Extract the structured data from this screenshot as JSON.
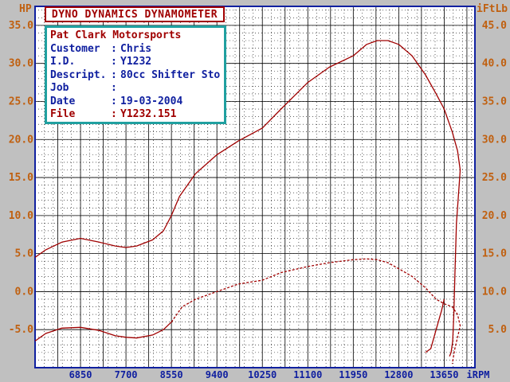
{
  "header": {
    "title": "DYNO DYNAMICS DYNAMOMETER",
    "left_axis_unit": "HP",
    "right_axis_unit": "iFtLb",
    "x_axis_unit": "iRPM"
  },
  "info": {
    "company": "Pat Clark Motorsports",
    "rows": [
      {
        "label": "Customer",
        "sep": ":",
        "value": "Chris"
      },
      {
        "label": "I.D.",
        "sep": ":",
        "value": "Y1232"
      },
      {
        "label": "Descript.",
        "sep": ":",
        "value": "80cc Shifter Sto"
      },
      {
        "label": "Job",
        "sep": ":",
        "value": ""
      },
      {
        "label": "Date",
        "sep": ":",
        "value": "19-03-2004"
      },
      {
        "label": "File",
        "sep": ":",
        "value": "Y1232.151"
      }
    ]
  },
  "colors": {
    "background": "#c0c0c0",
    "plot_bg": "#ffffff",
    "grid": "#000000",
    "axis_frame": "#1020a0",
    "left_tick_text": "#c06010",
    "right_tick_text": "#c06010",
    "x_tick_text": "#1020a0",
    "curve": "#a00000",
    "title_border": "#a00000",
    "info_border": "#20a0a0"
  },
  "chart_data": {
    "type": "line",
    "xlabel": "iRPM",
    "ylabel": "HP",
    "y2label": "iFtLb",
    "xlim": [
      6000,
      14225
    ],
    "ylim": [
      -10,
      37.5
    ],
    "y2lim": [
      0,
      47.5
    ],
    "x_ticks": [
      6850,
      7700,
      8550,
      9400,
      10250,
      11100,
      11950,
      12800,
      13650
    ],
    "y_ticks": [
      -5.0,
      0.0,
      5.0,
      10.0,
      15.0,
      20.0,
      25.0,
      30.0,
      35.0
    ],
    "y_tick_labels": [
      "-5.0",
      "0.0",
      "5.0",
      "10.0",
      "15.0",
      "20.0",
      "25.0",
      "30.0",
      "35.0"
    ],
    "y2_ticks": [
      5.0,
      10.0,
      15.0,
      20.0,
      25.0,
      30.0,
      35.0,
      40.0,
      45.0
    ],
    "y2_tick_labels": [
      "5.0",
      "10.0",
      "15.0",
      "20.0",
      "25.0",
      "30.0",
      "35.0",
      "40.0",
      "45.0"
    ],
    "grid": true,
    "series": [
      {
        "axis": "right",
        "style": "solid",
        "x": [
          6000,
          6200,
          6500,
          6850,
          7200,
          7500,
          7700,
          7900,
          8200,
          8400,
          8550,
          8700,
          9000,
          9400,
          9800,
          10250,
          10600,
          11100,
          11500,
          11950,
          12200,
          12400,
          12600,
          12800,
          13050,
          13300,
          13500,
          13650,
          13800,
          13900,
          13950,
          13930,
          13880,
          13850,
          13830,
          13810,
          13780,
          13750
        ],
        "y": [
          14.5,
          15.5,
          16.5,
          17.0,
          16.5,
          16.0,
          15.8,
          16.0,
          16.8,
          18.0,
          20.0,
          22.5,
          25.5,
          28.0,
          29.8,
          31.5,
          34.0,
          37.5,
          39.5,
          41.0,
          42.5,
          43.0,
          43.0,
          42.5,
          41.0,
          38.5,
          36.0,
          34.0,
          31.0,
          28.5,
          26.0,
          24.0,
          19.0,
          12.0,
          7.0,
          3.5,
          2.0,
          1.5
        ]
      },
      {
        "axis": "right",
        "style": "solid",
        "x": [
          13300,
          13400,
          13500,
          13600,
          13650
        ],
        "y": [
          2.0,
          2.5,
          5.0,
          7.5,
          9.0
        ]
      },
      {
        "axis": "left",
        "style": "solid",
        "x": [
          6000,
          6200,
          6500,
          6850,
          7200,
          7500,
          7700,
          7900,
          8200,
          8400,
          8550
        ],
        "y": [
          -6.5,
          -5.5,
          -4.8,
          -4.7,
          -5.1,
          -5.8,
          -6.0,
          -6.1,
          -5.7,
          -5.0,
          -4.0
        ]
      },
      {
        "axis": "left",
        "style": "dashed",
        "x": [
          8550,
          8750,
          9000,
          9400,
          9800,
          10250,
          10600,
          11100,
          11500,
          11950,
          12200,
          12400,
          12600,
          12800,
          13050,
          13300,
          13500,
          13650,
          13800,
          13900,
          13950,
          13900,
          13850,
          13800
        ],
        "y": [
          -4.0,
          -2.0,
          -1.0,
          0.0,
          1.0,
          1.5,
          2.5,
          3.3,
          3.8,
          4.2,
          4.3,
          4.2,
          3.8,
          3.0,
          2.0,
          0.5,
          -1.0,
          -1.6,
          -2.0,
          -3.0,
          -4.5,
          -6.0,
          -7.5,
          -9.5
        ]
      }
    ]
  }
}
